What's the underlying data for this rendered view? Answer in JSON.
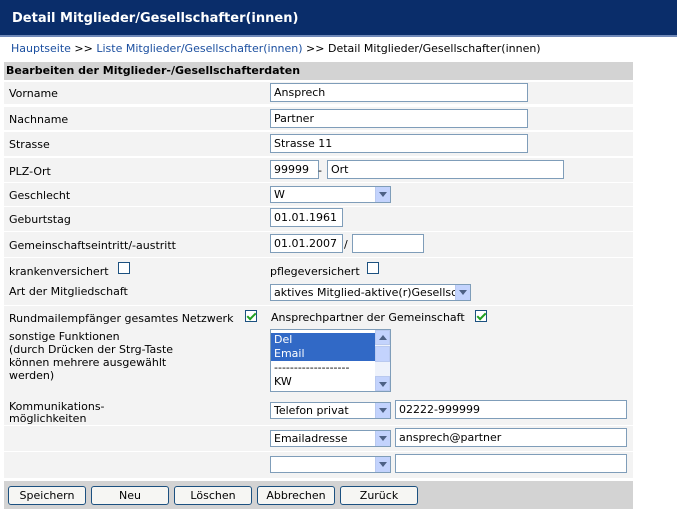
{
  "header": {
    "title": "Detail Mitglieder/Gesellschafter(innen)"
  },
  "breadcrumb": {
    "home": "Hauptseite",
    "sep1": " >> ",
    "list": "Liste Mitglieder/Gesellschafter(innen)",
    "sep2": " >> ",
    "current": "Detail Mitglieder/Gesellschafter(innen)"
  },
  "section": {
    "title": "Bearbeiten der Mitglieder-/Gesellschafterdaten"
  },
  "form": {
    "vorname": {
      "label": "Vorname",
      "value": "Ansprech"
    },
    "nachname": {
      "label": "Nachname",
      "value": "Partner"
    },
    "strasse": {
      "label": "Strasse",
      "value": "Strasse 11"
    },
    "plz_ort": {
      "label": "PLZ-Ort",
      "plz": "99999",
      "sep": "-",
      "ort": "Ort"
    },
    "geschlecht": {
      "label": "Geschlecht",
      "value": "W"
    },
    "geburtstag": {
      "label": "Geburtstag",
      "value": "01.01.1961"
    },
    "eintritt": {
      "label": "Gemeinschaftseintritt/-austritt",
      "eintritt": "01.01.2007",
      "sep": "/",
      "austritt": ""
    },
    "kranken": {
      "label": "krankenversichert",
      "checked": false
    },
    "pflege": {
      "label": "pflegeversichert",
      "checked": false
    },
    "mitgliedschaft": {
      "label": "Art der Mitgliedschaft",
      "value": "aktives Mitglied-aktive(r)Gesellsc"
    },
    "rundmail": {
      "label": "Rundmailempfänger gesamtes Netzwerk",
      "checked": true
    },
    "ansprechpartner": {
      "label": "Ansprechpartner der Gemeinschaft",
      "checked": true
    },
    "funktionen": {
      "label1": "sonstige Funktionen",
      "label2": "(durch Drücken der Strg-Taste",
      "label3": "können mehrere ausgewählt",
      "label4": "werden)",
      "options": [
        "Del",
        "Email",
        "-------------------",
        "KW"
      ]
    },
    "kommunikation": {
      "label1": "Kommunikations-",
      "label2": "möglichkeiten",
      "rows": [
        {
          "type": "Telefon privat",
          "value": "02222-999999"
        },
        {
          "type": "Emailadresse",
          "value": "ansprech@partner"
        },
        {
          "type": "",
          "value": ""
        }
      ]
    }
  },
  "buttons": {
    "save": "Speichern",
    "new": "Neu",
    "delete": "Löschen",
    "cancel": "Abbrechen",
    "back": "Zurück"
  }
}
